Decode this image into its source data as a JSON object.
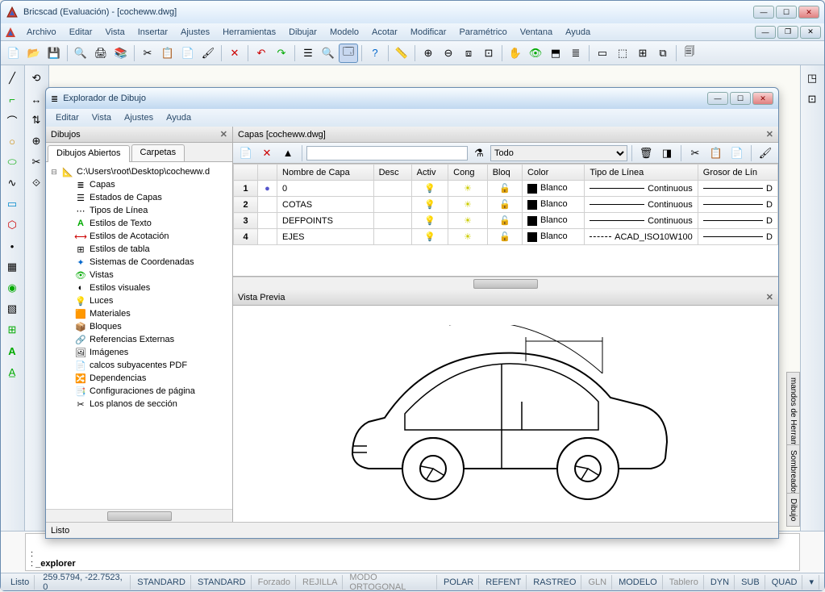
{
  "app": {
    "title": "Bricscad (Evaluación) - [cocheww.dwg]"
  },
  "menus": [
    "Archivo",
    "Editar",
    "Vista",
    "Insertar",
    "Ajustes",
    "Herramientas",
    "Dibujar",
    "Modelo",
    "Acotar",
    "Modificar",
    "Paramétrico",
    "Ventana",
    "Ayuda"
  ],
  "explorer": {
    "title": "Explorador de Dibujo",
    "menus": [
      "Editar",
      "Vista",
      "Ajustes",
      "Ayuda"
    ],
    "left_panel_title": "Dibujos",
    "tabs": [
      "Dibujos Abiertos",
      "Carpetas"
    ],
    "tree_root": "C:\\Users\\root\\Desktop\\cocheww.d",
    "tree_items": [
      {
        "icon": "layers",
        "label": "Capas"
      },
      {
        "icon": "layer-states",
        "label": "Estados de Capas"
      },
      {
        "icon": "linetype",
        "label": "Tipos de Línea"
      },
      {
        "icon": "text-style",
        "label": "Estilos de Texto"
      },
      {
        "icon": "dim-style",
        "label": "Estilos de Acotación"
      },
      {
        "icon": "table-style",
        "label": "Estilos de tabla"
      },
      {
        "icon": "coord-sys",
        "label": "Sistemas de Coordenadas"
      },
      {
        "icon": "views",
        "label": "Vistas"
      },
      {
        "icon": "visual-style",
        "label": "Estilos visuales"
      },
      {
        "icon": "lights",
        "label": "Luces"
      },
      {
        "icon": "materials",
        "label": "Materiales"
      },
      {
        "icon": "blocks",
        "label": "Bloques"
      },
      {
        "icon": "xref",
        "label": "Referencias Externas"
      },
      {
        "icon": "images",
        "label": "Imágenes"
      },
      {
        "icon": "pdf",
        "label": "calcos subyacentes PDF"
      },
      {
        "icon": "deps",
        "label": "Dependencias"
      },
      {
        "icon": "page-setup",
        "label": "Configuraciones de página"
      },
      {
        "icon": "section",
        "label": "Los planos de sección"
      }
    ],
    "layers_header": "Capas [cocheww.dwg]",
    "filter_dropdown": "Todo",
    "table": {
      "columns": [
        "",
        "",
        "Nombre de Capa",
        "Desc",
        "Activ",
        "Cong",
        "Bloq",
        "Color",
        "Tipo de Línea",
        "Grosor de Lín"
      ],
      "rows": [
        {
          "n": "1",
          "current": true,
          "name": "0",
          "on": true,
          "freeze": true,
          "lock": false,
          "color": "Blanco",
          "linetype": "Continuous",
          "dash": false,
          "weight": "D"
        },
        {
          "n": "2",
          "current": false,
          "name": "COTAS",
          "on": true,
          "freeze": true,
          "lock": false,
          "color": "Blanco",
          "linetype": "Continuous",
          "dash": false,
          "weight": "D"
        },
        {
          "n": "3",
          "current": false,
          "name": "DEFPOINTS",
          "on": true,
          "freeze": true,
          "lock": false,
          "color": "Blanco",
          "linetype": "Continuous",
          "dash": false,
          "weight": "D"
        },
        {
          "n": "4",
          "current": false,
          "name": "EJES",
          "on": true,
          "freeze": true,
          "lock": false,
          "color": "Blanco",
          "linetype": "ACAD_ISO10W100",
          "dash": true,
          "weight": "D"
        }
      ]
    },
    "preview_title": "Vista Previa",
    "status": "Listo"
  },
  "command": {
    "prompt": ":",
    "text": "_explorer"
  },
  "statusbar": {
    "ready": "Listo",
    "coords": "259.5794, -22.7523, 0",
    "std1": "STANDARD",
    "std2": "STANDARD",
    "segments": [
      {
        "label": "Forzado",
        "dim": true
      },
      {
        "label": "REJILLA",
        "dim": true
      },
      {
        "label": "MODO ORTOGONAL",
        "dim": true
      },
      {
        "label": "POLAR",
        "dim": false
      },
      {
        "label": "REFENT",
        "dim": false
      },
      {
        "label": "RASTREO",
        "dim": false
      },
      {
        "label": "GLN",
        "dim": true
      },
      {
        "label": "MODELO",
        "dim": false
      },
      {
        "label": "Tablero",
        "dim": true
      },
      {
        "label": "DYN",
        "dim": false
      },
      {
        "label": "SUB",
        "dim": false
      },
      {
        "label": "QUAD",
        "dim": false
      }
    ]
  },
  "side_tabs": [
    "mandos de Herramient",
    "Sombreados",
    "Dibujo"
  ]
}
